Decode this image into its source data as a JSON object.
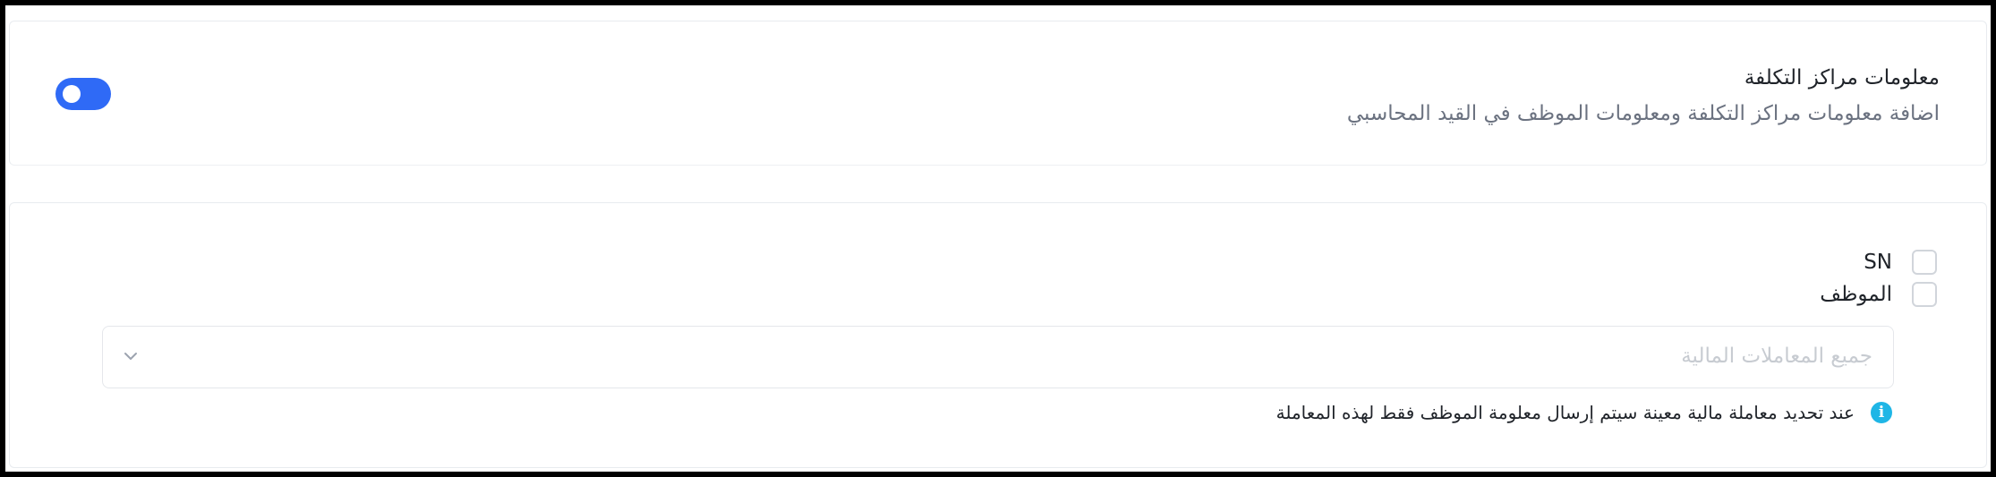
{
  "section": {
    "title": "معلومات مراكز التكلفة",
    "subtitle": "اضافة معلومات مراكز التكلفة ومعلومات الموظف في القيد المحاسبي",
    "toggle_on": true,
    "accent_color": "#2f6af6"
  },
  "options": [
    {
      "label": "SN",
      "checked": false
    },
    {
      "label": "الموظف",
      "checked": false
    }
  ],
  "transaction_select": {
    "placeholder": "جميع المعاملات المالية",
    "icon": "chevron-down-icon"
  },
  "hint": {
    "icon": "info-icon",
    "text": "عند تحديد معاملة مالية معينة سيتم إرسال معلومة الموظف فقط لهذه المعاملة",
    "icon_color": "#1fb6e6"
  }
}
